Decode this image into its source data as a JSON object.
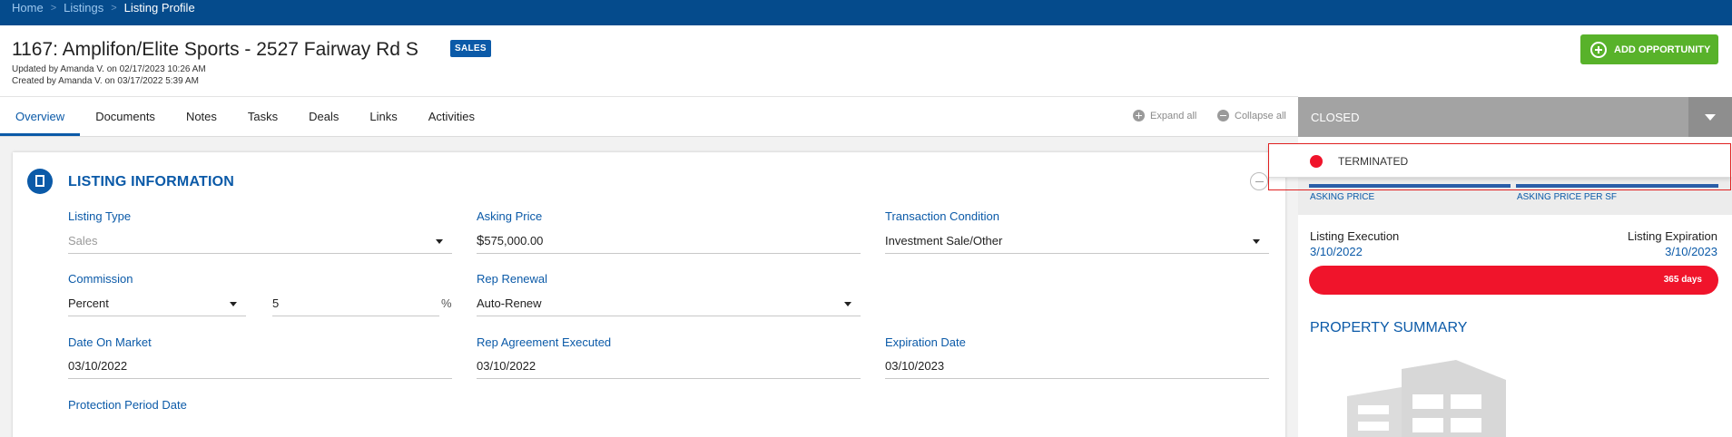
{
  "breadcrumb": {
    "home": "Home",
    "listings": "Listings",
    "current": "Listing Profile",
    "separator": ">"
  },
  "header": {
    "title": "1167: Amplifon/Elite Sports - 2527 Fairway Rd S",
    "badge": "SALES",
    "updated": "Updated by Amanda V. on 02/17/2023 10:26 AM",
    "created": "Created by Amanda V. on 03/17/2022 5:39 AM",
    "add_opportunity": "ADD OPPORTUNITY"
  },
  "tabs": [
    {
      "label": "Overview",
      "active": true
    },
    {
      "label": "Documents"
    },
    {
      "label": "Notes"
    },
    {
      "label": "Tasks"
    },
    {
      "label": "Deals"
    },
    {
      "label": "Links"
    },
    {
      "label": "Activities"
    }
  ],
  "controls": {
    "expand_all": "Expand all",
    "collapse_all": "Collapse all"
  },
  "listing_info": {
    "title": "LISTING INFORMATION",
    "listing_type": {
      "label": "Listing Type",
      "value": "Sales"
    },
    "asking_price": {
      "label": "Asking Price",
      "currency": "$",
      "value": "575,000.00"
    },
    "transaction_condition": {
      "label": "Transaction Condition",
      "value": "Investment Sale/Other"
    },
    "commission": {
      "label": "Commission",
      "type": "Percent",
      "amount": "5",
      "unit": "%"
    },
    "rep_renewal": {
      "label": "Rep Renewal",
      "value": "Auto-Renew"
    },
    "date_on_market": {
      "label": "Date On Market",
      "value": "03/10/2022"
    },
    "rep_agreement_executed": {
      "label": "Rep Agreement Executed",
      "value": "03/10/2022"
    },
    "expiration_date": {
      "label": "Expiration Date",
      "value": "03/10/2023"
    },
    "protection_period_date": {
      "label": "Protection Period Date",
      "value": ""
    }
  },
  "side": {
    "status": "CLOSED",
    "dropdown_option": "TERMINATED",
    "asking_price_label": "ASKING PRICE",
    "asking_price_per_sf_label": "ASKING PRICE PER SF",
    "listing_execution_label": "Listing Execution",
    "listing_execution_value": "3/10/2022",
    "listing_expiration_label": "Listing Expiration",
    "listing_expiration_value": "3/10/2023",
    "days": "365 days",
    "property_summary": "PROPERTY SUMMARY"
  },
  "colors": {
    "brand_blue": "#054b8c",
    "accent_blue": "#0b5aa8",
    "green": "#58b22a",
    "red": "#f0142b",
    "status_grey": "#a3a3a3"
  }
}
